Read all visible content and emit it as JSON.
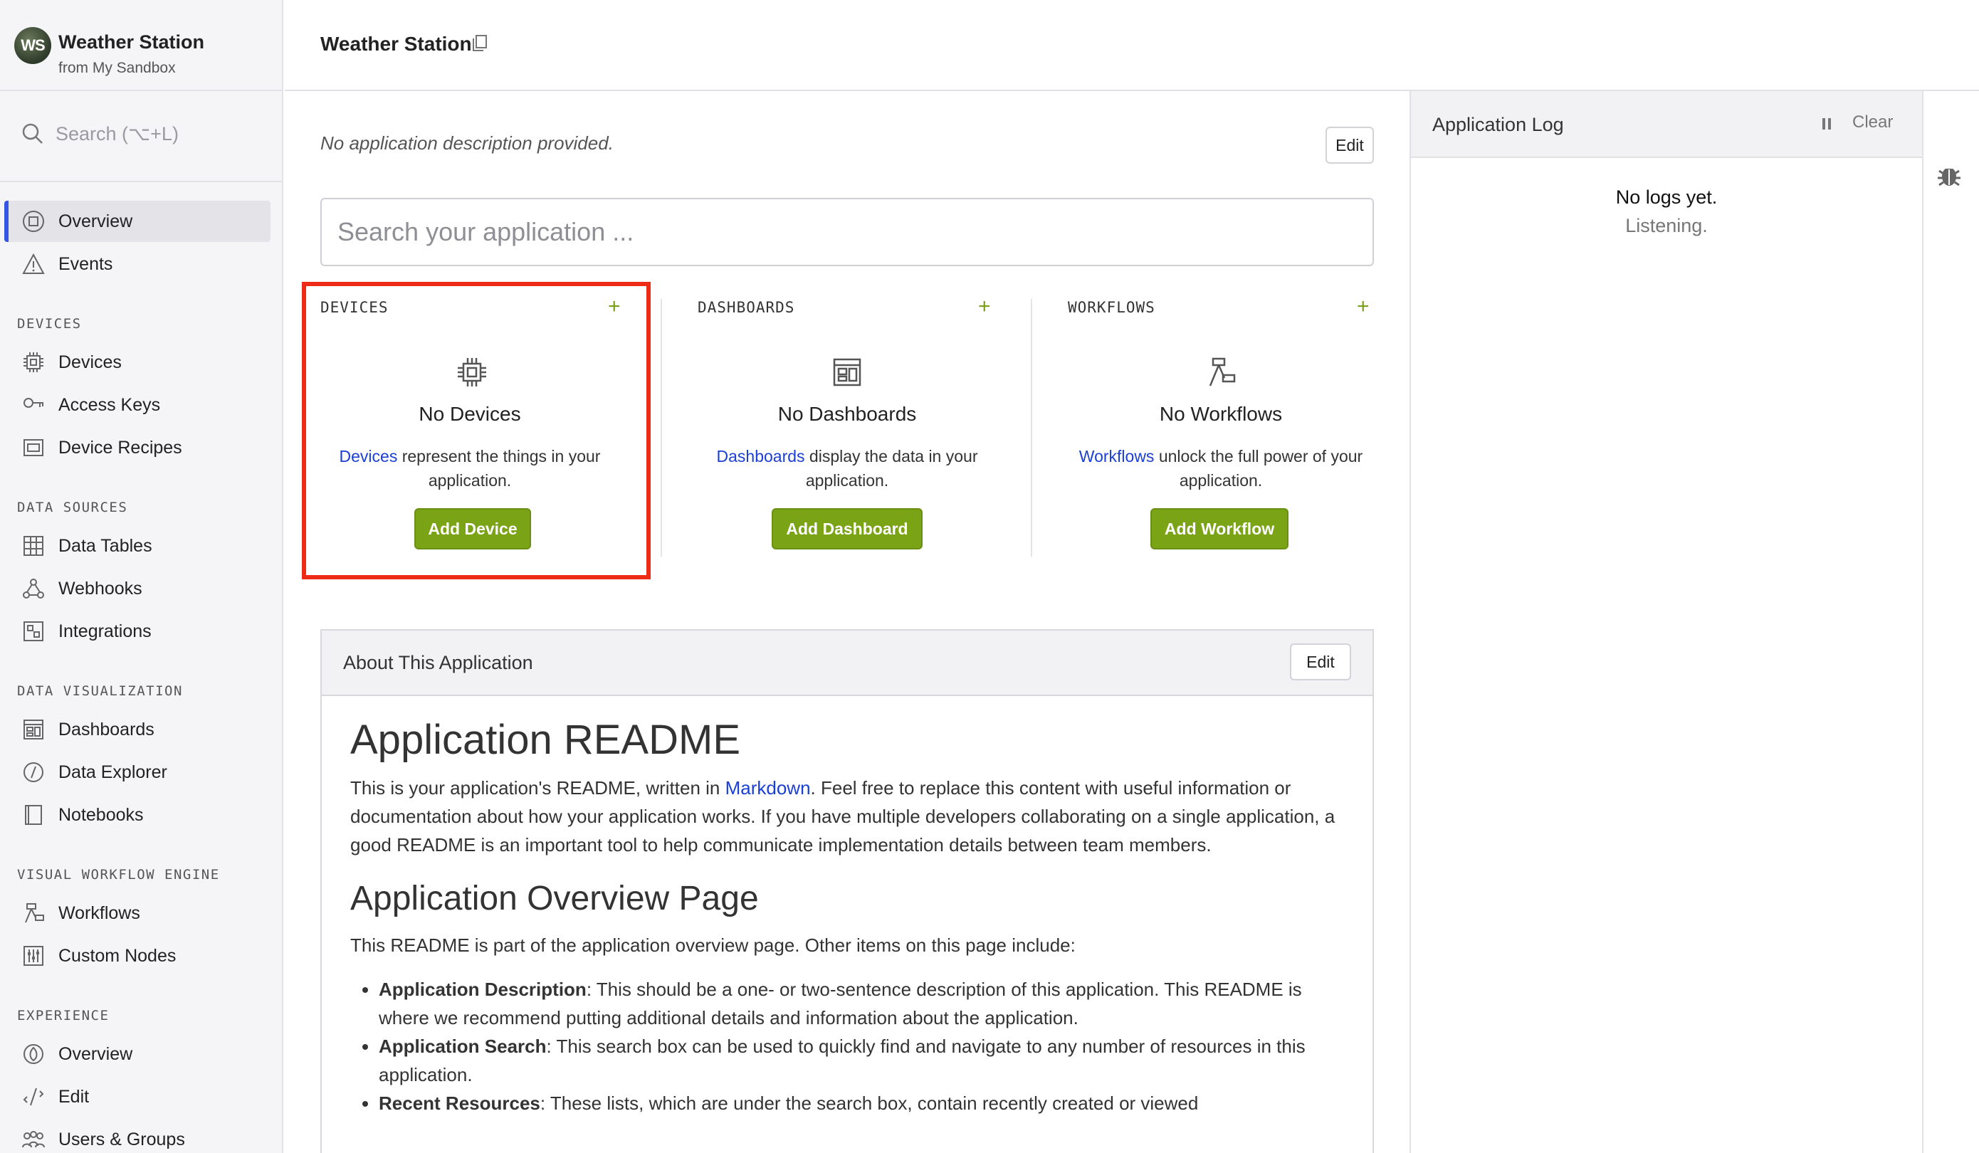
{
  "app": {
    "avatar_initials": "WS",
    "name": "Weather Station",
    "source": "from My Sandbox"
  },
  "sidebar": {
    "search_placeholder": "Search (⌥+L)",
    "top_items": [
      {
        "label": "Overview",
        "icon": "overview-icon",
        "active": true
      },
      {
        "label": "Events",
        "icon": "warning-icon"
      }
    ],
    "sections": [
      {
        "title": "DEVICES",
        "items": [
          {
            "label": "Devices",
            "icon": "chip-icon"
          },
          {
            "label": "Access Keys",
            "icon": "key-icon"
          },
          {
            "label": "Device Recipes",
            "icon": "recipe-icon"
          }
        ]
      },
      {
        "title": "DATA SOURCES",
        "items": [
          {
            "label": "Data Tables",
            "icon": "table-icon"
          },
          {
            "label": "Webhooks",
            "icon": "webhook-icon"
          },
          {
            "label": "Integrations",
            "icon": "integrations-icon"
          }
        ]
      },
      {
        "title": "DATA VISUALIZATION",
        "items": [
          {
            "label": "Dashboards",
            "icon": "dashboard-icon"
          },
          {
            "label": "Data Explorer",
            "icon": "explorer-icon"
          },
          {
            "label": "Notebooks",
            "icon": "notebook-icon"
          }
        ]
      },
      {
        "title": "VISUAL WORKFLOW ENGINE",
        "items": [
          {
            "label": "Workflows",
            "icon": "workflow-icon"
          },
          {
            "label": "Custom Nodes",
            "icon": "custom-nodes-icon"
          }
        ]
      },
      {
        "title": "EXPERIENCE",
        "items": [
          {
            "label": "Overview",
            "icon": "experience-overview-icon"
          },
          {
            "label": "Edit",
            "icon": "edit-icon"
          },
          {
            "label": "Users & Groups",
            "icon": "users-icon"
          }
        ]
      }
    ]
  },
  "topbar": {
    "title": "Weather Station"
  },
  "main": {
    "description": "No application description provided.",
    "edit_label": "Edit",
    "search_placeholder": "Search your application ...",
    "columns": [
      {
        "heading": "DEVICES",
        "title": "No Devices",
        "link": "Devices",
        "text": " represent the things in your application.",
        "button": "Add Device"
      },
      {
        "heading": "DASHBOARDS",
        "title": "No Dashboards",
        "link": "Dashboards",
        "text": " display the data in your application.",
        "button": "Add Dashboard"
      },
      {
        "heading": "WORKFLOWS",
        "title": "No Workflows",
        "link": "Workflows",
        "text": " unlock the full power of your application.",
        "button": "Add Workflow"
      }
    ],
    "about": {
      "title": "About This Application",
      "edit_label": "Edit",
      "h1": "Application README",
      "p1_before": "This is your application's README, written in ",
      "p1_link": "Markdown",
      "p1_after": ". Feel free to replace this content with useful information or documentation about how your application works. If you have multiple developers collaborating on a single application, a good README is an important tool to help communicate implementation details between team members.",
      "h2": "Application Overview Page",
      "p2": "This README is part of the application overview page. Other items on this page include:",
      "list": [
        {
          "term": "Application Description",
          "text": ": This should be a one- or two-sentence description of this application. This README is where we recommend putting additional details and information about the application."
        },
        {
          "term": "Application Search",
          "text": ": This search box can be used to quickly find and navigate to any number of resources in this application."
        },
        {
          "term": "Recent Resources",
          "text": ": These lists, which are under the search box, contain recently created or viewed"
        }
      ]
    }
  },
  "log": {
    "title": "Application Log",
    "clear_label": "Clear",
    "empty": "No logs yet.",
    "listening": "Listening."
  },
  "colors": {
    "accent": "#3357e0",
    "green": "#7aa416",
    "highlight": "#ee2b16",
    "link": "#1a3fd6"
  }
}
